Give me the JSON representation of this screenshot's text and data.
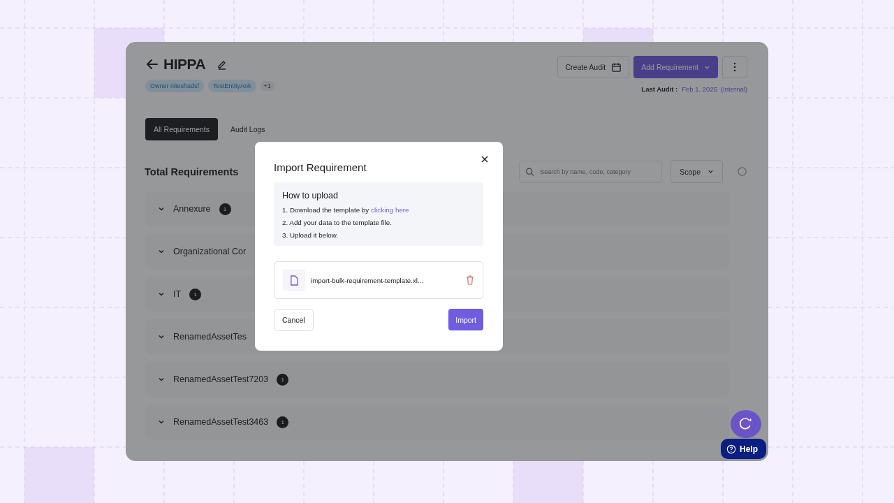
{
  "header": {
    "title": "HIPPA",
    "tags": [
      {
        "label": "Owner niteshadsf",
        "kind": "tag"
      },
      {
        "label": "TestEntityAnk",
        "kind": "tag"
      },
      {
        "label": "+1",
        "kind": "more"
      }
    ],
    "create_audit": "Create Audit",
    "add_requirement": "Add Requirement",
    "last_audit": {
      "label": "Last Audit :",
      "date": "Feb 1, 2025",
      "type": "(Internal)"
    }
  },
  "tabs": [
    {
      "label": "All Requirements",
      "selected": true
    },
    {
      "label": "Audit Logs",
      "selected": false
    }
  ],
  "requirements": {
    "title": "Total Requirements",
    "search": {
      "placeholder": "Search by name, code, category"
    },
    "scope": "Scope",
    "groups": [
      {
        "name": "Annexure",
        "count": "1"
      },
      {
        "name": "Organizational Cor"
      },
      {
        "name": "IT",
        "count": "1"
      },
      {
        "name": "RenamedAssetTes"
      },
      {
        "name": "RenamedAssetTest7203",
        "count": "1"
      },
      {
        "name": "RenamedAssetTest3463",
        "count": "1"
      }
    ]
  },
  "dialog": {
    "title": "Import Requirement",
    "howto_title": "How to upload",
    "steps": [
      {
        "text": "1. Download the template by",
        "link": "clicking here"
      },
      {
        "text": "2. Add your data to the template file."
      },
      {
        "text": "3. Upload it below."
      }
    ],
    "file": "import-bulk-requirement-template.xl...",
    "cancel": "Cancel",
    "import": "Import"
  },
  "help": "Help"
}
